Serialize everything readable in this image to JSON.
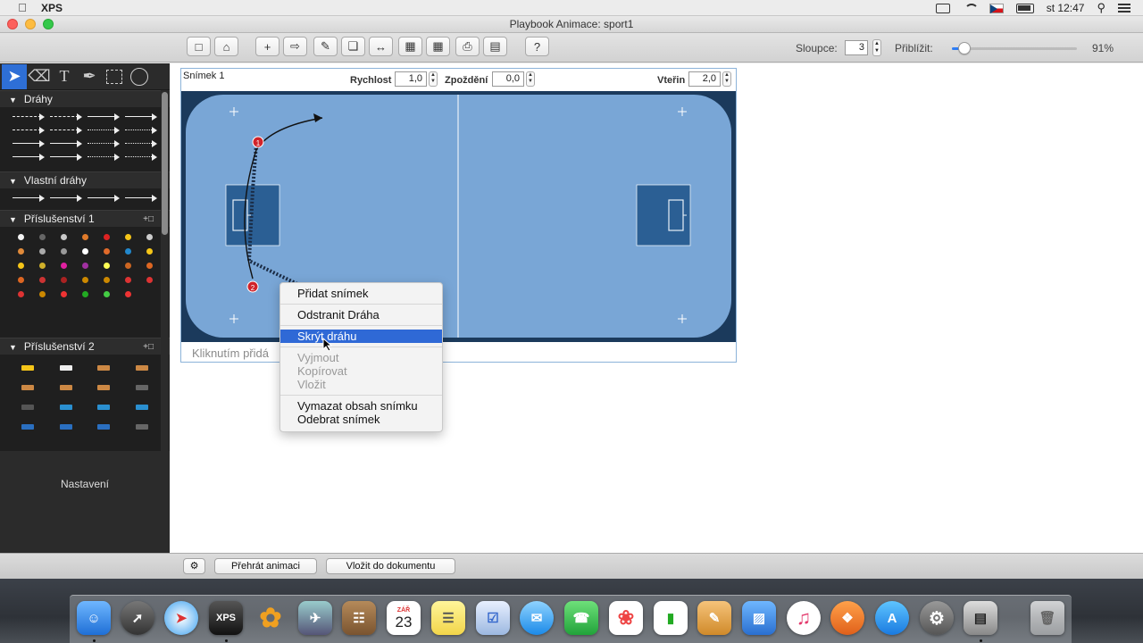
{
  "menubar": {
    "app_name": "XPS",
    "clock": "st 12:47"
  },
  "window": {
    "title": "Playbook Animace: sport1"
  },
  "toolbar": {
    "columns_label": "Sloupce:",
    "columns_value": "3",
    "zoom_label": "Přiblížit:",
    "zoom_value": "91%",
    "zoom_fraction": 0.1
  },
  "palette": {
    "sections": [
      {
        "title": "Dráhy"
      },
      {
        "title": "Vlastní dráhy"
      },
      {
        "title": "Příslušenství 1"
      },
      {
        "title": "Příslušenství 2"
      }
    ],
    "settings_label": "Nastavení"
  },
  "frame": {
    "title": "Snímek 1",
    "speed_label": "Rychlost",
    "speed_value": "1,0",
    "delay_label": "Zpoždění",
    "delay_value": "0,0",
    "seconds_label": "Vteřin",
    "seconds_value": "2,0",
    "hint": "Kliknutím přidá"
  },
  "context_menu": {
    "items": [
      {
        "label": "Přidat snímek"
      },
      {
        "label": "Odstranit Dráha"
      },
      {
        "label": "Skrýt dráhu"
      },
      {
        "label": "Vyjmout"
      },
      {
        "label": "Kopírovat"
      },
      {
        "label": "Vložit"
      },
      {
        "label": "Vymazat obsah snímku"
      },
      {
        "label": "Odebrat snímek"
      }
    ]
  },
  "field": {
    "player_1": "1",
    "player_2": "2"
  },
  "bottombar": {
    "play_label": "Přehrát animaci",
    "insert_label": "Vložit do dokumentu"
  },
  "dock": {
    "xps_label": "XPS",
    "calendar_month": "ZÁŘ",
    "calendar_day": "23"
  },
  "colors": {
    "accent": "#2f69d6",
    "court": "#79a6d6",
    "court_border": "#1b3a5c",
    "key": "#2b5f94",
    "player": "#d1232a"
  }
}
